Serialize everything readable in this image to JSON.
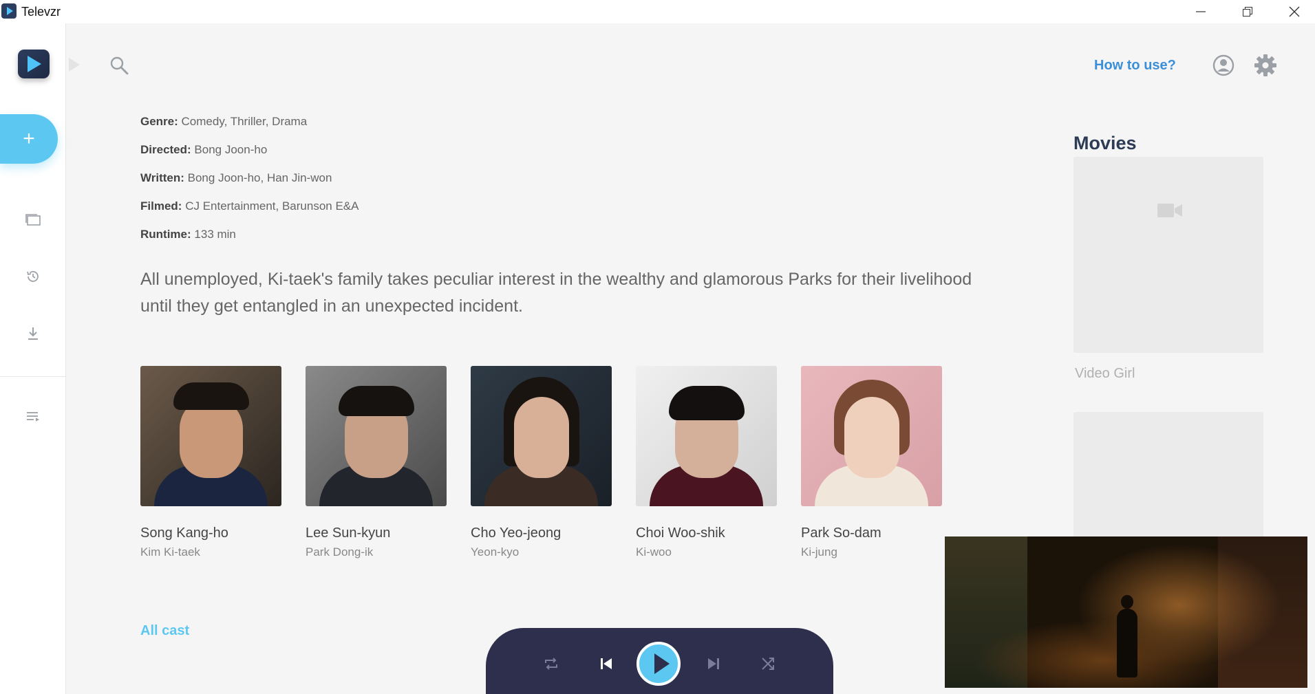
{
  "window": {
    "app_title": "Televzr"
  },
  "topbar": {
    "howto_label": "How to use?"
  },
  "sidebar": {
    "add_label": "+",
    "items": [
      {
        "icon": "library-icon"
      },
      {
        "icon": "history-icon"
      },
      {
        "icon": "download-icon"
      },
      {
        "icon": "playlist-icon"
      }
    ]
  },
  "details": {
    "genre_label": "Genre:",
    "genre_value": "Comedy, Thriller, Drama",
    "directed_label": "Directed:",
    "directed_value": "Bong Joon-ho",
    "written_label": "Written:",
    "written_value": "Bong Joon-ho, Han Jin-won",
    "filmed_label": "Filmed:",
    "filmed_value": "CJ Entertainment, Barunson E&A",
    "runtime_label": "Runtime:",
    "runtime_value": "133 min",
    "synopsis": "All unemployed, Ki-taek's family takes peculiar interest in the wealthy and glamorous Parks for their livelihood until they get entangled in an unexpected incident."
  },
  "cast": [
    {
      "name": "Song Kang-ho",
      "role": "Kim Ki-taek"
    },
    {
      "name": "Lee Sun-kyun",
      "role": "Park Dong-ik"
    },
    {
      "name": "Cho Yeo-jeong",
      "role": "Yeon-kyo"
    },
    {
      "name": "Choi Woo-shik",
      "role": "Ki-woo"
    },
    {
      "name": "Park So-dam",
      "role": "Ki-jung"
    }
  ],
  "all_cast_label": "All cast",
  "movies": {
    "title": "Movies",
    "items": [
      {
        "title": "Video Girl"
      }
    ]
  },
  "colors": {
    "accent": "#5cc8f2",
    "link": "#3b8ed8",
    "player_bg": "#2d2f4d"
  }
}
